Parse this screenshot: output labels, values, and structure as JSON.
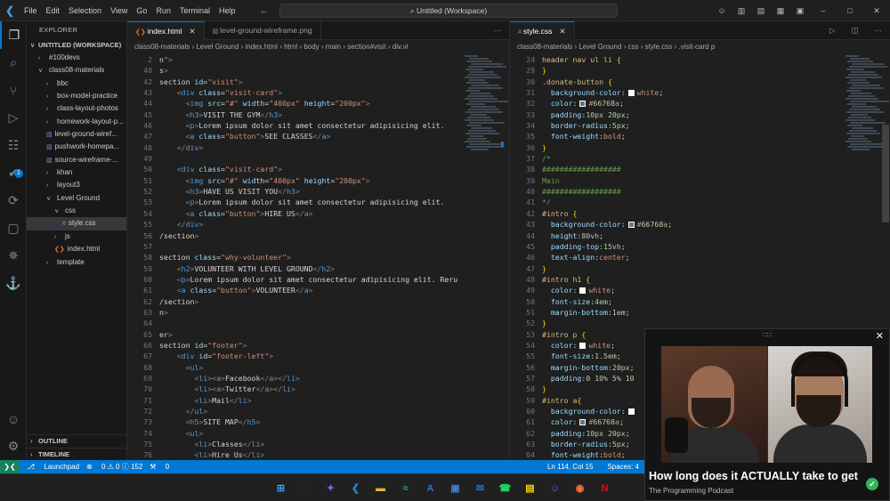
{
  "titlebar": {
    "menu": [
      "File",
      "Edit",
      "Selection",
      "View",
      "Go",
      "Run",
      "Terminal",
      "Help"
    ],
    "search": "Untitled (Workspace)"
  },
  "explorer": {
    "title": "EXPLORER",
    "workspace": "UNTITLED (WORKSPACE)",
    "items": [
      {
        "label": "#100devs",
        "indent": 1,
        "type": "folder"
      },
      {
        "label": "class08-materials",
        "indent": 1,
        "type": "folder-open"
      },
      {
        "label": "bbc",
        "indent": 2,
        "type": "folder"
      },
      {
        "label": "box-model-practice",
        "indent": 2,
        "type": "folder"
      },
      {
        "label": "class-layout-photos",
        "indent": 2,
        "type": "folder"
      },
      {
        "label": "homework-layout-p...",
        "indent": 2,
        "type": "folder"
      },
      {
        "label": "level-ground-wiref...",
        "indent": 2,
        "type": "image"
      },
      {
        "label": "pushwork-homepa...",
        "indent": 2,
        "type": "image"
      },
      {
        "label": "source-wireframe-...",
        "indent": 2,
        "type": "image"
      },
      {
        "label": "khan",
        "indent": 2,
        "type": "folder"
      },
      {
        "label": "layout3",
        "indent": 2,
        "type": "folder"
      },
      {
        "label": "Level Ground",
        "indent": 2,
        "type": "folder-open"
      },
      {
        "label": "css",
        "indent": 3,
        "type": "folder-open"
      },
      {
        "label": "style.css",
        "indent": 4,
        "type": "css",
        "selected": true
      },
      {
        "label": "js",
        "indent": 3,
        "type": "folder"
      },
      {
        "label": "index.html",
        "indent": 3,
        "type": "html"
      },
      {
        "label": "template",
        "indent": 2,
        "type": "folder"
      }
    ],
    "outline": "OUTLINE",
    "timeline": "TIMELINE"
  },
  "left_editor": {
    "tabs": [
      {
        "label": "index.html",
        "active": true
      },
      {
        "label": "level-ground-wireframe.png",
        "active": false
      }
    ],
    "breadcrumb": [
      "class08-materials",
      "Level Ground",
      "index.html",
      "html",
      "body",
      "main",
      "section#visit",
      "div.vi"
    ],
    "lines": [
      {
        "n": "2",
        "code": "n\">"
      },
      {
        "n": "40",
        "code": "s>"
      },
      {
        "n": "42",
        "code": "section id=\"visit\">"
      },
      {
        "n": "43",
        "code": "    <div class=\"visit-card\">"
      },
      {
        "n": "44",
        "code": "      <img src=\"#\" width=\"400px\" height=\"200px\">"
      },
      {
        "n": "45",
        "code": "      <h3>VISIT THE GYM</h3>"
      },
      {
        "n": "46",
        "code": "      <p>Lorem ipsum dolor sit amet consectetur adipisicing elit."
      },
      {
        "n": "47",
        "code": "      <a class=\"button\">SEE CLASSES</a>"
      },
      {
        "n": "48",
        "code": "    </div>"
      },
      {
        "n": "49",
        "code": ""
      },
      {
        "n": "50",
        "code": "    <div class=\"visit-card\">"
      },
      {
        "n": "51",
        "code": "      <img src=\"#\" width=\"400px\" height=\"200px\">"
      },
      {
        "n": "52",
        "code": "      <h3>HAVE US VISIT YOU</h3>"
      },
      {
        "n": "53",
        "code": "      <p>Lorem ipsum dolor sit amet consectetur adipisicing elit."
      },
      {
        "n": "54",
        "code": "      <a class=\"button\">HIRE US</a>"
      },
      {
        "n": "55",
        "code": "    </div>"
      },
      {
        "n": "56",
        "code": "/section>"
      },
      {
        "n": "57",
        "code": ""
      },
      {
        "n": "58",
        "code": "section class=\"why-volunteer\">"
      },
      {
        "n": "59",
        "code": "    <h2>VOLUNTEER WITH LEVEL GROUND</h2>"
      },
      {
        "n": "60",
        "code": "    <p>Lorem ipsum dolor sit amet consectetur adipisicing elit. Reru"
      },
      {
        "n": "61",
        "code": "    <a class=\"button\">VOLUNTEER</a>"
      },
      {
        "n": "62",
        "code": "/section>"
      },
      {
        "n": "63",
        "code": "n>"
      },
      {
        "n": "64",
        "code": ""
      },
      {
        "n": "65",
        "code": "er>"
      },
      {
        "n": "66",
        "code": "section id=\"footer\">"
      },
      {
        "n": "67",
        "code": "    <div id=\"footer-left\">"
      },
      {
        "n": "68",
        "code": "      <ul>"
      },
      {
        "n": "69",
        "code": "        <li><a>Facebook</a></li>"
      },
      {
        "n": "70",
        "code": "        <li><a>Twitter</a></li>"
      },
      {
        "n": "71",
        "code": "        <li>Mail</li>"
      },
      {
        "n": "72",
        "code": "      </ul>"
      },
      {
        "n": "73",
        "code": "      <h5>SITE MAP</h5>"
      },
      {
        "n": "74",
        "code": "      <ul>"
      },
      {
        "n": "75",
        "code": "        <li>Classes</li>"
      },
      {
        "n": "76",
        "code": "        <li>Hire Us</li>"
      }
    ]
  },
  "right_editor": {
    "tabs": [
      {
        "label": "style.css",
        "active": true
      }
    ],
    "breadcrumb": [
      "class08-materials",
      "Level Ground",
      "css",
      "style.css",
      ".visit-card p"
    ],
    "lines": [
      {
        "n": "24",
        "code": "header nav ul li {"
      },
      {
        "n": "29",
        "code": "}"
      },
      {
        "n": "30",
        "code": ".donate-button {"
      },
      {
        "n": "31",
        "code": "  background-color: white;",
        "swatch": "#ffffff"
      },
      {
        "n": "32",
        "code": "  color: #66768a;",
        "swatch": "#66768a"
      },
      {
        "n": "33",
        "code": "  padding: 10px 20px;"
      },
      {
        "n": "34",
        "code": "  border-radius: 5px;"
      },
      {
        "n": "35",
        "code": "  font-weight: bold;"
      },
      {
        "n": "36",
        "code": "}"
      },
      {
        "n": "37",
        "code": "/*"
      },
      {
        "n": "38",
        "code": "##################"
      },
      {
        "n": "39",
        "code": "Main"
      },
      {
        "n": "40",
        "code": "##################"
      },
      {
        "n": "41",
        "code": "*/"
      },
      {
        "n": "42",
        "code": "#intro {"
      },
      {
        "n": "43",
        "code": "  background-color: #66768a;",
        "swatch": "#66768a"
      },
      {
        "n": "44",
        "code": "  height: 80vh;"
      },
      {
        "n": "45",
        "code": "  padding-top: 15vh;"
      },
      {
        "n": "46",
        "code": "  text-align: center;"
      },
      {
        "n": "47",
        "code": "}"
      },
      {
        "n": "48",
        "code": "#intro h1 {"
      },
      {
        "n": "49",
        "code": "  color: white;",
        "swatch": "#ffffff"
      },
      {
        "n": "50",
        "code": "  font-size: 4em;"
      },
      {
        "n": "51",
        "code": "  margin-bottom: 1em;"
      },
      {
        "n": "52",
        "code": "}"
      },
      {
        "n": "53",
        "code": "#intro p {"
      },
      {
        "n": "54",
        "code": "  color: white;",
        "swatch": "#ffffff"
      },
      {
        "n": "55",
        "code": "  font-size: 1.5em;"
      },
      {
        "n": "56",
        "code": "  margin-bottom: 20px;"
      },
      {
        "n": "57",
        "code": "  padding: 0 10% 5% 10"
      },
      {
        "n": "58",
        "code": "}"
      },
      {
        "n": "59",
        "code": "#intro a{"
      },
      {
        "n": "60",
        "code": "  background-color:",
        "swatch": "#ffffff"
      },
      {
        "n": "61",
        "code": "  color: #66768a;",
        "swatch": "#66768a"
      },
      {
        "n": "62",
        "code": "  padding: 10px 20px;"
      },
      {
        "n": "63",
        "code": "  border-radius: 5px;"
      },
      {
        "n": "64",
        "code": "  font-weight: bold;"
      }
    ]
  },
  "statusbar": {
    "branch": "Launchpad",
    "problems": "0 ⚠ 0 ⓘ 152",
    "ports": "0",
    "position": "Ln 114, Col 15",
    "spaces": "Spaces: 4"
  },
  "popup": {
    "title": "How long does it ACTUALLY take to get",
    "subtitle": "The Programming Podcast"
  },
  "taskbar": {
    "icons": [
      "windows-start",
      "terminal",
      "copilot",
      "vscode",
      "file-explorer",
      "spotify",
      "app-store",
      "photos",
      "mail",
      "whatsapp",
      "sticky-notes",
      "discord",
      "firefox",
      "netflix"
    ]
  },
  "colors": {
    "accent": "#0078d4",
    "swatch_blue": "#66768a"
  }
}
